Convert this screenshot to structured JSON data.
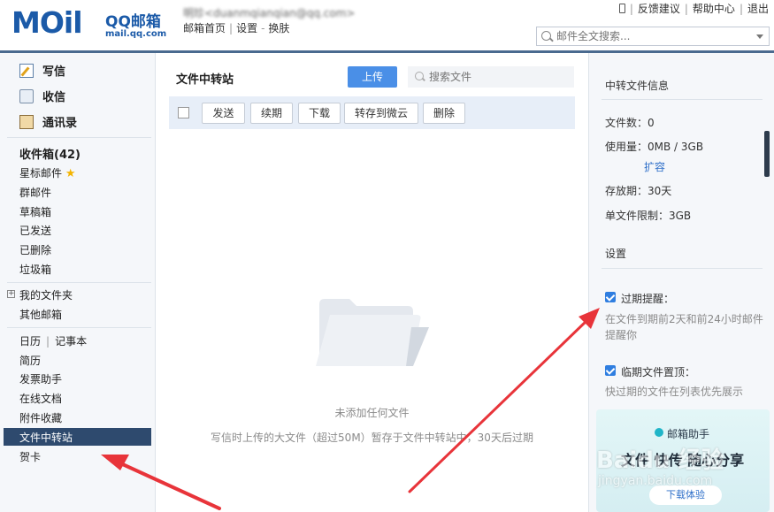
{
  "header": {
    "logo_big": "MOil",
    "logo_qq": "QQ邮箱",
    "logo_url": "mail.qq.com",
    "user_line": "明珍<duanmqianqian@qq.com>",
    "links": [
      "邮箱首页",
      "设置",
      "换肤"
    ],
    "top_right": [
      "反馈建议",
      "帮助中心",
      "退出"
    ],
    "search_placeholder": "邮件全文搜索..."
  },
  "sidebar": {
    "write": "写信",
    "inbox_top": "收信",
    "contacts": "通讯录",
    "inbox": "收件箱(42)",
    "starred": "星标邮件",
    "group": "群邮件",
    "drafts": "草稿箱",
    "sent": "已发送",
    "deleted": "已删除",
    "spam": "垃圾箱",
    "my_folders": "我的文件夹",
    "other_mailboxes": "其他邮箱",
    "calendar": "日历",
    "notes": "记事本",
    "resume": "简历",
    "invoice": "发票助手",
    "online_docs": "在线文档",
    "attachments": "附件收藏",
    "file_transfer": "文件中转站",
    "greeting_cards": "贺卡"
  },
  "main": {
    "title": "文件中转站",
    "upload": "上传",
    "search_placeholder": "搜索文件",
    "toolbar": [
      "发送",
      "续期",
      "下载",
      "转存到微云",
      "删除"
    ],
    "empty_text": "未添加任何文件",
    "empty_sub": "写信时上传的大文件（超过50M）暂存于文件中转站中，30天后过期"
  },
  "right": {
    "info_title": "中转文件信息",
    "file_count": "文件数：0",
    "usage": "使用量：0MB / 3GB",
    "expand": "扩容",
    "retention": "存放期：30天",
    "single_limit": "单文件限制：3GB",
    "settings_title": "设置",
    "expire_reminder": "过期提醒：",
    "expire_desc": "在文件到期前2天和前24小时邮件提醒你",
    "pin_expiring": "临期文件置顶：",
    "pin_desc": "快过期的文件在列表优先展示",
    "banner_title": "邮箱助手",
    "banner_big": "文件 快传 随心分享",
    "banner_btn": "下载体验"
  },
  "watermark": {
    "line1": "Baidu 经验",
    "line2": "jingyan.baidu.com"
  },
  "colors": {
    "brand": "#1b5aa8",
    "active_item": "#2e4a6e",
    "upload_button": "#4a8fe7",
    "arrow": "#e8343a",
    "checkbox": "#2f7ee0"
  }
}
